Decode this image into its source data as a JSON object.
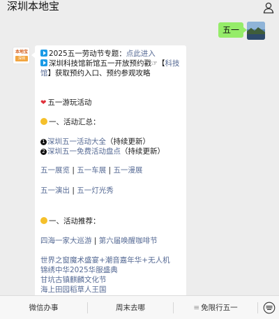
{
  "header": {
    "title": "深圳本地宝",
    "user_icon": "user-icon"
  },
  "outgoing": {
    "text": "五一"
  },
  "bot": {
    "avatar_line1": "本地宝",
    "avatar_line2": "深圳",
    "lines": {
      "l1_text": "2025五一劳动节专题：",
      "l1_link": "点此进入",
      "l2_text": "深圳科技馆新馆五一开放预约戳",
      "l2_bracket_open": "【",
      "l2_link": "科技",
      "l3_link": "馆",
      "l3_text": "】获取预约入口、预约参观攻略",
      "heading1": "五一游玩活动",
      "sec1": "一、活动汇总：",
      "item1_num": "1",
      "item1_link": "深圳五一活动大全",
      "item1_note": "（持续更新）",
      "item2_num": "2",
      "item2_link": "深圳五一免费活动盘点",
      "item2_note": "（持续更新）",
      "row_a": [
        "五一展览",
        "五一车展",
        "五一漫展"
      ],
      "row_b": [
        "五一演出",
        "五一灯光秀"
      ],
      "sep": " | ",
      "sec2": "一、活动推荐：",
      "rec1": [
        "四海一家大巡游",
        "第六届唤醒咖啡节"
      ],
      "rec2": "世界之窗魔术盛宴+潮音嘉年华+无人机",
      "rec3": "锦绣中华2025华服盛典",
      "rec4": "甘坑古镇麒麟文化节",
      "rec5": "海上田园稻草人王国"
    }
  },
  "menu": {
    "items": [
      "微信办事",
      "周末去哪",
      "免限行五一"
    ],
    "third_prefix": "≡",
    "keyboard_icon": "keyboard-icon"
  },
  "colors": {
    "link": "#576b95",
    "bubble_out": "#95ec69",
    "bg": "#ededed"
  }
}
